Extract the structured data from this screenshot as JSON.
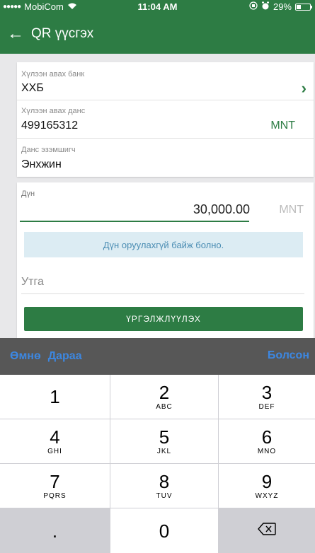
{
  "status_bar": {
    "carrier": "MobiCom",
    "time": "11:04 AM",
    "battery": "29%"
  },
  "app_bar": {
    "title": "QR үүсгэх"
  },
  "form": {
    "bank": {
      "label": "Хүлээн авах банк",
      "value": "ХХБ"
    },
    "account": {
      "label": "Хүлээн авах данс",
      "value": "499165312",
      "currency": "MNT"
    },
    "holder": {
      "label": "Данс эзэмшигч",
      "value": "Энхжин"
    },
    "amount": {
      "label": "Дүн",
      "value": "30,000.00",
      "currency": "MNT"
    },
    "info_message": "Дүн оруулахгүй байж болно.",
    "description_placeholder": "Утга",
    "continue_label": "ҮРГЭЛЖЛҮҮЛЭХ"
  },
  "keyboard": {
    "prev_label": "Өмнө",
    "next_label": "Дараа",
    "done_label": "Болсон",
    "keys": [
      {
        "num": "1",
        "letters": ""
      },
      {
        "num": "2",
        "letters": "ABC"
      },
      {
        "num": "3",
        "letters": "DEF"
      },
      {
        "num": "4",
        "letters": "GHI"
      },
      {
        "num": "5",
        "letters": "JKL"
      },
      {
        "num": "6",
        "letters": "MNO"
      },
      {
        "num": "7",
        "letters": "PQRS"
      },
      {
        "num": "8",
        "letters": "TUV"
      },
      {
        "num": "9",
        "letters": "WXYZ"
      },
      {
        "num": ".",
        "letters": ""
      },
      {
        "num": "0",
        "letters": ""
      },
      {
        "num": "⌫",
        "letters": ""
      }
    ]
  },
  "colors": {
    "brand_green": "#2d7c44",
    "link_blue": "#3d87e0",
    "info_bg": "#dcecf3",
    "info_text": "#4b8db3"
  }
}
